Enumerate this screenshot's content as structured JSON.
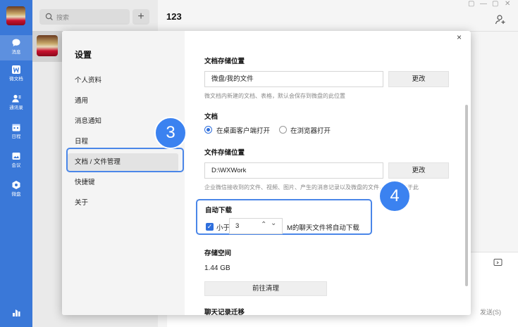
{
  "rail": {
    "items": [
      {
        "label": "消息",
        "icon": "chat-bubble-icon"
      },
      {
        "label": "微文档",
        "icon": "doc-w-icon"
      },
      {
        "label": "通讯录",
        "icon": "contacts-icon"
      },
      {
        "label": "日程",
        "icon": "calendar-icon"
      },
      {
        "label": "会议",
        "icon": "meeting-icon"
      },
      {
        "label": "微盘",
        "icon": "drive-icon"
      }
    ]
  },
  "sessions": {
    "search_placeholder": "搜索",
    "add_label": "+"
  },
  "chat": {
    "title": "123",
    "window_controls": [
      "▢",
      "—",
      "▢",
      "✕"
    ],
    "send_label": "发送(S)"
  },
  "dialog": {
    "title": "设置",
    "close_label": "×",
    "menu": [
      "个人资料",
      "通用",
      "消息通知",
      "日程",
      "文档 / 文件管理",
      "快捷键",
      "关于"
    ],
    "selected_index": 4,
    "badges": [
      "3",
      "4"
    ],
    "doc_section": {
      "title": "文档存储位置",
      "value": "微盘/我的文件",
      "button": "更改",
      "hint": "微文档内新建的文档、表格，默认会保存到微盘的此位置"
    },
    "open_section": {
      "title": "文档",
      "options": [
        "在桌面客户端打开",
        "在浏览器打开"
      ],
      "selected": 0
    },
    "file_section": {
      "title": "文件存储位置",
      "value": "D:\\WXWork",
      "button": "更改",
      "hint": "企业微信接收到的文件、视频、图片、产生的消息记录以及微盘的文件，都将存放于此"
    },
    "auto_download": {
      "title": "自动下载",
      "checked": true,
      "prefix": "小于",
      "value": "3",
      "suffix": "M的聊天文件将自动下载"
    },
    "storage": {
      "title": "存储空间",
      "size": "1.44 GB",
      "button": "前往清理"
    },
    "migrate_title": "聊天记录迁移"
  },
  "colors": {
    "rail": "#3a78d8",
    "accent": "#2f6fdd",
    "highlight": "#4a86e8",
    "badge": "#3b82f0"
  }
}
